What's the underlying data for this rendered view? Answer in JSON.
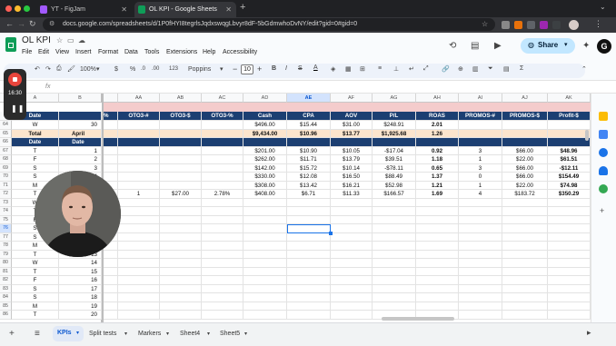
{
  "browser": {
    "tabs": [
      {
        "title": "YT - FigJam",
        "color": "#a259ff",
        "active": false
      },
      {
        "title": "OL KPI - Google Sheets",
        "color": "#0f9d58",
        "active": true
      }
    ],
    "new_tab": "+",
    "url": "docs.google.com/spreadsheets/d/1P0fHYI8tegrlsJqdxswqgLbvyr8dF-5bGdmwhoDvNY/edit?gid=0#gid=0"
  },
  "sheet": {
    "title": "OL KPI",
    "menus": [
      "File",
      "Edit",
      "View",
      "Insert",
      "Format",
      "Data",
      "Tools",
      "Extensions",
      "Help",
      "Accessibility"
    ],
    "share_label": "Share",
    "zoom": "100%",
    "currency_symbol": "$",
    "percent_symbol": "%",
    "decimals_less": ".0",
    "decimals_more": ".00",
    "number_format": "123",
    "font": "Poppins",
    "font_size": "10",
    "fx": "fx",
    "avatar_letter": "G"
  },
  "recorder": {
    "time": "16:30"
  },
  "grid": {
    "left_columns": [
      {
        "letter": "A",
        "header": "Date"
      },
      {
        "letter": "B",
        "header": "Date"
      }
    ],
    "columns": [
      {
        "letter": "AA",
        "header": "OTO3-#"
      },
      {
        "letter": "AB",
        "header": "OTO3-$"
      },
      {
        "letter": "AC",
        "header": "OTO3-%"
      },
      {
        "letter": "AD",
        "header": "Cash"
      },
      {
        "letter": "AE",
        "header": "CPA"
      },
      {
        "letter": "AF",
        "header": "AOV"
      },
      {
        "letter": "AG",
        "header": "P/L"
      },
      {
        "letter": "AH",
        "header": "ROAS"
      },
      {
        "letter": "AI",
        "header": "PROMOS-#"
      },
      {
        "letter": "AJ",
        "header": "PROMOS-$"
      },
      {
        "letter": "AK",
        "header": "Profit-$"
      }
    ],
    "partial_col_header": "%",
    "header_row": {
      "a": "Date",
      "b": ""
    },
    "rows": [
      {
        "num": "64",
        "a": "W",
        "b": "30",
        "cells": [
          "",
          "",
          "",
          "$496.00",
          "$15.44",
          "$31.00",
          "$248.91",
          "2.01",
          "",
          "",
          ""
        ],
        "style": "normal"
      },
      {
        "num": "65",
        "a": "Total",
        "b": "April",
        "cells": [
          "",
          "",
          "",
          "$9,434.00",
          "$10.96",
          "$13.77",
          "$1,925.68",
          "1.26",
          "",
          "",
          ""
        ],
        "style": "total"
      },
      {
        "num": "66",
        "a": "Date",
        "b": "Date",
        "cells": [
          "",
          "",
          "",
          "",
          "",
          "",
          "",
          "",
          "",
          "",
          ""
        ],
        "style": "blank"
      },
      {
        "num": "67",
        "a": "T",
        "b": "1",
        "cells": [
          "",
          "",
          "",
          "$201.00",
          "$10.90",
          "$10.05",
          "-$17.04",
          "0.92",
          "3",
          "$66.00",
          "$48.96"
        ],
        "style": "normal"
      },
      {
        "num": "68",
        "a": "F",
        "b": "2",
        "cells": [
          "",
          "",
          "",
          "$262.00",
          "$11.71",
          "$13.79",
          "$39.51",
          "1.18",
          "1",
          "$22.00",
          "$61.51"
        ],
        "style": "normal"
      },
      {
        "num": "69",
        "a": "S",
        "b": "3",
        "cells": [
          "",
          "",
          "",
          "$142.00",
          "$15.72",
          "$10.14",
          "-$78.11",
          "0.65",
          "3",
          "$66.00",
          "-$12.11"
        ],
        "style": "normal"
      },
      {
        "num": "70",
        "a": "S",
        "b": "4",
        "cells": [
          "",
          "",
          "",
          "$330.00",
          "$12.08",
          "$16.50",
          "$88.49",
          "1.37",
          "0",
          "$66.00",
          "$154.49"
        ],
        "style": "normal"
      },
      {
        "num": "71",
        "a": "M",
        "b": "5",
        "cells": [
          "",
          "",
          "",
          "$308.00",
          "$13.42",
          "$16.21",
          "$52.98",
          "1.21",
          "1",
          "$22.00",
          "$74.98"
        ],
        "style": "normal"
      },
      {
        "num": "72",
        "a": "T",
        "b": "6",
        "cells": [
          "1",
          "$27.00",
          "2.78%",
          "$408.00",
          "$6.71",
          "$11.33",
          "$166.57",
          "1.69",
          "4",
          "$183.72",
          "$350.29"
        ],
        "style": "normal"
      },
      {
        "num": "73",
        "a": "W",
        "b": "7",
        "cells": [],
        "style": "empty"
      },
      {
        "num": "74",
        "a": "T",
        "b": "8",
        "cells": [],
        "style": "empty"
      },
      {
        "num": "75",
        "a": "F",
        "b": "9",
        "cells": [],
        "style": "empty"
      },
      {
        "num": "76",
        "a": "S",
        "b": "10",
        "cells": [],
        "style": "empty"
      },
      {
        "num": "77",
        "a": "S",
        "b": "11",
        "cells": [],
        "style": "empty"
      },
      {
        "num": "78",
        "a": "M",
        "b": "12",
        "cells": [],
        "style": "empty"
      },
      {
        "num": "79",
        "a": "T",
        "b": "13",
        "cells": [],
        "style": "empty"
      },
      {
        "num": "80",
        "a": "W",
        "b": "14",
        "cells": [],
        "style": "empty"
      },
      {
        "num": "81",
        "a": "T",
        "b": "15",
        "cells": [],
        "style": "empty"
      },
      {
        "num": "82",
        "a": "F",
        "b": "16",
        "cells": [],
        "style": "empty"
      },
      {
        "num": "83",
        "a": "S",
        "b": "17",
        "cells": [],
        "style": "empty"
      },
      {
        "num": "84",
        "a": "S",
        "b": "18",
        "cells": [],
        "style": "empty"
      },
      {
        "num": "85",
        "a": "M",
        "b": "19",
        "cells": [],
        "style": "empty"
      },
      {
        "num": "86",
        "a": "T",
        "b": "20",
        "cells": [],
        "style": "empty"
      }
    ]
  },
  "sheet_tabs": [
    "KPIs",
    "Split tests",
    "Markers",
    "Sheet4",
    "Sheet5"
  ],
  "colors": {
    "header_blue": "#1c3f72",
    "total_fill": "#fce5cd",
    "pink_band": "#f4cccc",
    "share_blue": "#c2e7ff",
    "sheets_green": "#0f9d58",
    "selection_blue": "#1a73e8"
  }
}
